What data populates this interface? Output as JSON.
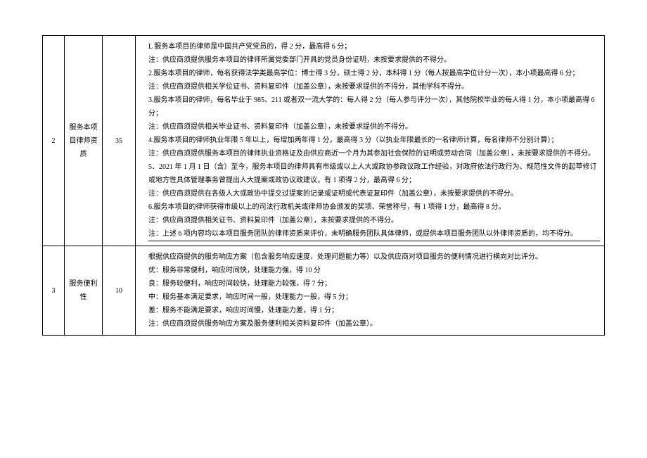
{
  "rows": [
    {
      "index": "2",
      "name": "服务本项目律师资质",
      "score": "35",
      "body": [
        "L 服务本项目的律师是中国共产党党员的，得 2 分，最高得 6 分；",
        "注：供应商须提供服务本项目的律师所属党委部门开具的党员身份证明，未按要求提供的不得分。",
        "2.服务本项目的律师，每名获得法学类最高学位：博士得 3 分，硕士得 2 分，本科得 1 分（每人按最高学位计分一次），本小项最高得 6 分；",
        "注：供应商须提供相关学位证书、资料复印件（加盖公章），未按要求提供的不得分，其他学科不得分。",
        "3.服务本项目的律师，每名毕业于 985、211 或者双一流大学的：每人得 2 分（每人参与评分一次），其他院校毕业的每人得 1 分，本小项最高得 6 分；",
        "注：供应商须提供相关毕业证书、资料复印件（加盖公章），未按要求提供的不得分。",
        "4.服务本项目的律师执业年限 5 年以上，每增加两年得 1 分，最高得 3 分（以执业年限最长的一名律师计算，每名律师不分别计算）；",
        "注：供应商须提供服务本项目的律师执业资格证及由供应商近一个月为其参加社会保险的证明或劳动合同（加盖公章），未按要求提供的不得分。",
        "5．2021 年 1 月 1 日（含）至今，服务本项目的律师具有市级或以上人大或政协参政议政工作经验，对政府依法行政行为、规范性文件的起草修订或地方性具体管理事务曾提出人大提案或政协议政建议，有 1 项得 2 分，最高得 6 分；",
        "注：供应商须提供在各级人大或政协中提交过提案的记录或证明或代表证复印件（加盖公章），未按要求提供的不得分。",
        "6.服务本项目的律师获得市级以上的司法行政机关或律师协会颁发的奖项、荣誉称号，有 1 项得 1 分，最高得 8 分。",
        "注：供应商须提供相关证书、资料复印件（加盖公章），未按要求提供的不得分。",
        "注：上述 6 项内容均以本项目服务团队的律师资质来评价，未明确服务团队具体律师，或提供本项目服务团队以外律师资质的，均不得分。"
      ]
    },
    {
      "index": "3",
      "name": "服务便利性",
      "score": "10",
      "body": [
        "根据供应商提供的服务响应方案（包含服务响应速度、处理问题能力等）以及供应商对项目服务的便利情况进行横向对比评分。",
        "优：服务非常便利，响应时间快，处理能力强，得 10 分",
        "良：服务较便利，响应时间较快，处理能力较强，得 7 分；",
        "中：服务基本满足要求，响应时间一般，处理能力一般，得 5 分；",
        "差：服务不能满足要求，响应时间慢，处理能力差，得 1 分；",
        "注：供应商须提供服务响应方案及服务便利相关资料复印件（加盖公章）。"
      ]
    }
  ]
}
